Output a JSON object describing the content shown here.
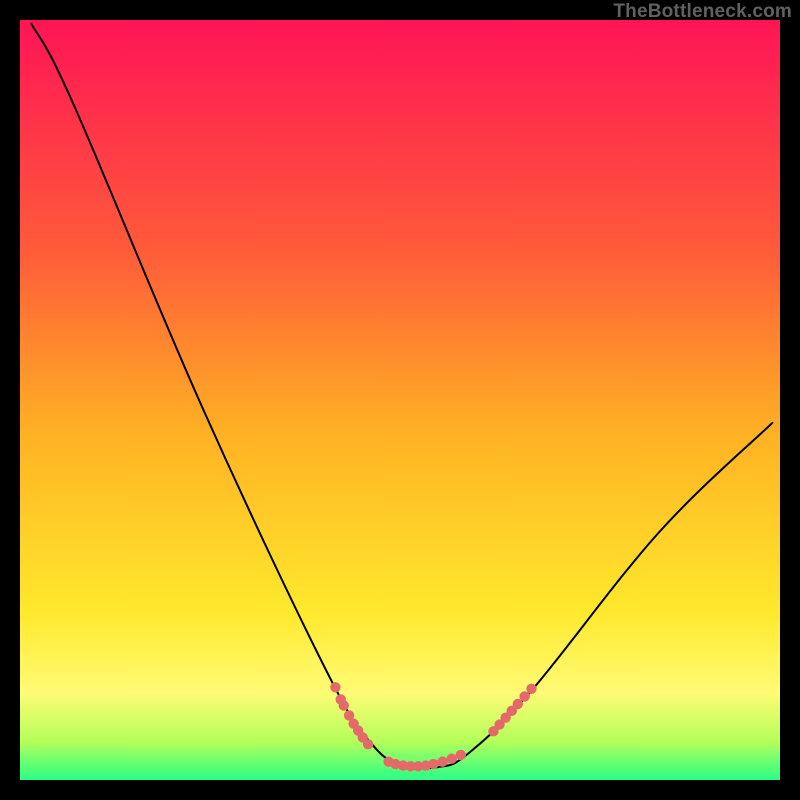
{
  "watermark": "TheBottleneck.com",
  "chart_data": {
    "type": "line",
    "title": "",
    "xlabel": "",
    "ylabel": "",
    "xlim": [
      0,
      100
    ],
    "ylim": [
      0,
      100
    ],
    "background_gradient": {
      "stops": [
        {
          "offset": 0,
          "color": "#ff1456"
        },
        {
          "offset": 0.3,
          "color": "#ff5a3a"
        },
        {
          "offset": 0.55,
          "color": "#ffb323"
        },
        {
          "offset": 0.78,
          "color": "#ffe92d"
        },
        {
          "offset": 0.885,
          "color": "#fffb75"
        },
        {
          "offset": 0.95,
          "color": "#b3ff5a"
        },
        {
          "offset": 1.0,
          "color": "#29ff86"
        }
      ]
    },
    "series": [
      {
        "name": "bottleneck-curve",
        "type": "curve",
        "color": "#000000",
        "points": [
          {
            "x": 1.5,
            "y": 99.5
          },
          {
            "x": 7.0,
            "y": 89.0
          },
          {
            "x": 24.0,
            "y": 49.0
          },
          {
            "x": 40.5,
            "y": 14.0
          },
          {
            "x": 46.5,
            "y": 4.5
          },
          {
            "x": 50.5,
            "y": 2.0
          },
          {
            "x": 55.0,
            "y": 1.7
          },
          {
            "x": 59.0,
            "y": 3.5
          },
          {
            "x": 67.5,
            "y": 12.0
          },
          {
            "x": 84.0,
            "y": 32.5
          },
          {
            "x": 99.0,
            "y": 47.0
          }
        ]
      },
      {
        "name": "scatter-left",
        "type": "scatter",
        "color": "#e46a6a",
        "points": [
          {
            "x": 41.5,
            "y": 12.2
          },
          {
            "x": 42.2,
            "y": 10.6
          },
          {
            "x": 42.6,
            "y": 9.8
          },
          {
            "x": 43.3,
            "y": 8.5
          },
          {
            "x": 43.9,
            "y": 7.4
          },
          {
            "x": 44.5,
            "y": 6.5
          },
          {
            "x": 45.1,
            "y": 5.6
          },
          {
            "x": 45.8,
            "y": 4.7
          }
        ]
      },
      {
        "name": "scatter-floor",
        "type": "scatter",
        "color": "#e46a6a",
        "points": [
          {
            "x": 48.5,
            "y": 2.4
          },
          {
            "x": 49.4,
            "y": 2.1
          },
          {
            "x": 50.4,
            "y": 1.9
          },
          {
            "x": 51.4,
            "y": 1.8
          },
          {
            "x": 52.4,
            "y": 1.8
          },
          {
            "x": 53.4,
            "y": 1.9
          },
          {
            "x": 54.4,
            "y": 2.1
          },
          {
            "x": 55.6,
            "y": 2.4
          },
          {
            "x": 56.8,
            "y": 2.8
          },
          {
            "x": 58.0,
            "y": 3.3
          }
        ]
      },
      {
        "name": "scatter-right",
        "type": "scatter",
        "color": "#e46a6a",
        "points": [
          {
            "x": 62.3,
            "y": 6.4
          },
          {
            "x": 63.1,
            "y": 7.3
          },
          {
            "x": 63.9,
            "y": 8.2
          },
          {
            "x": 64.7,
            "y": 9.1
          },
          {
            "x": 65.5,
            "y": 10.0
          },
          {
            "x": 66.4,
            "y": 11.0
          },
          {
            "x": 67.3,
            "y": 12.0
          }
        ]
      }
    ]
  }
}
